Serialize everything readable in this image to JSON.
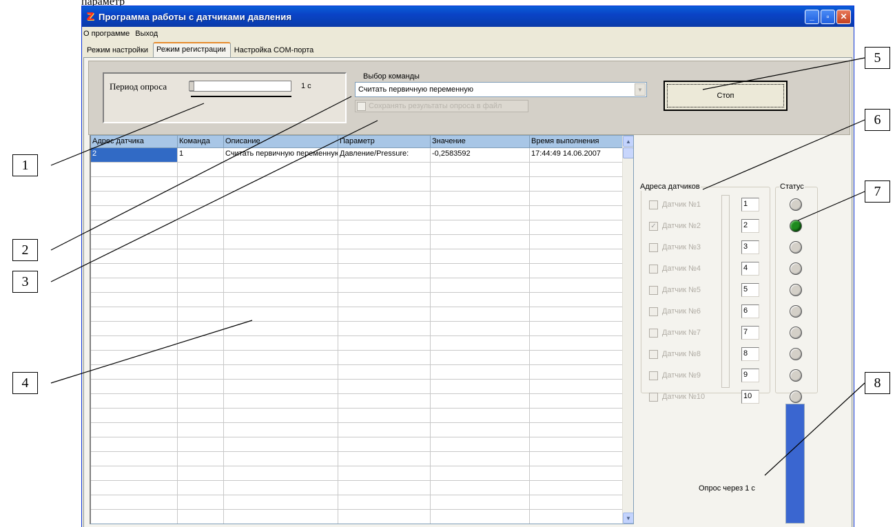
{
  "header_fragment": "параметр",
  "window": {
    "title": "Программа работы с датчиками давления",
    "controls": {
      "minimize": "_",
      "maximize": "▫",
      "close": "✕"
    }
  },
  "menu": [
    "О программе",
    "Выход"
  ],
  "tabs": [
    {
      "label": "Режим настройки",
      "active": false
    },
    {
      "label": "Режим регистрации",
      "active": true
    },
    {
      "label": "Настройка COM-порта",
      "active": false
    }
  ],
  "period": {
    "label": "Период опроса",
    "unit": "1 с"
  },
  "command": {
    "label": "Выбор команды",
    "selected": "Считать первичную переменную",
    "save_label": "Сохранять результаты опроса в файл",
    "save_checked": false
  },
  "stop_label": "Стоп",
  "table": {
    "columns": [
      "Адрес датчика",
      "Команда",
      "Описание",
      "Параметр",
      "Значение",
      "Время выполнения"
    ],
    "rows": [
      [
        "2",
        "1",
        "Считать первичную переменную",
        "Давление/Pressure:",
        "-0,2583592",
        "17:44:49 14.06.2007"
      ]
    ]
  },
  "addresses": {
    "title": "Адреса датчиков",
    "items": [
      {
        "label": "Датчик №1",
        "checked": false,
        "value": "1"
      },
      {
        "label": "Датчик №2",
        "checked": true,
        "value": "2"
      },
      {
        "label": "Датчик №3",
        "checked": false,
        "value": "3"
      },
      {
        "label": "Датчик №4",
        "checked": false,
        "value": "4"
      },
      {
        "label": "Датчик №5",
        "checked": false,
        "value": "5"
      },
      {
        "label": "Датчик №6",
        "checked": false,
        "value": "6"
      },
      {
        "label": "Датчик №7",
        "checked": false,
        "value": "7"
      },
      {
        "label": "Датчик №8",
        "checked": false,
        "value": "8"
      },
      {
        "label": "Датчик №9",
        "checked": false,
        "value": "9"
      },
      {
        "label": "Датчик №10",
        "checked": false,
        "value": "10"
      }
    ]
  },
  "status": {
    "title": "Статус",
    "leds": [
      false,
      true,
      false,
      false,
      false,
      false,
      false,
      false,
      false,
      false
    ]
  },
  "progress_fraction": 1.0,
  "poll_label": "Опрос через 1 с",
  "callouts": [
    "1",
    "2",
    "3",
    "4",
    "5",
    "6",
    "7",
    "8"
  ],
  "colors": {
    "titlebar": "#0a43c6",
    "selection": "#316ac5",
    "led_on": "#1e8a1e",
    "progress": "#3a66d0",
    "header_row": "#a8c6e6"
  }
}
